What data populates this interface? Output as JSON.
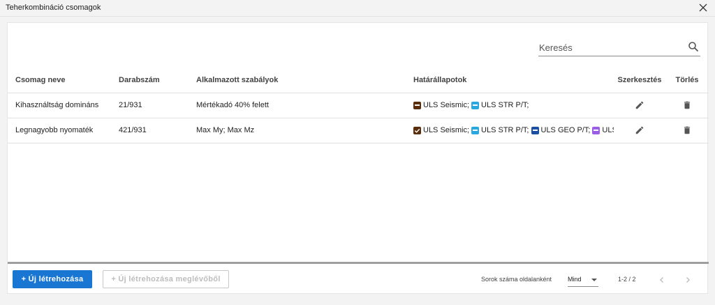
{
  "window": {
    "title": "Teherkombináció csomagok"
  },
  "search": {
    "placeholder": "Keresés"
  },
  "table": {
    "columns": [
      "Csomag neve",
      "Darabszám",
      "Alkalmazott szabályok",
      "Határállapotok",
      "Szerkesztés",
      "Törlés"
    ],
    "rows": [
      {
        "name": "Kihasználtság domináns",
        "count": "21/931",
        "rules": "Mértékadó 40% felett",
        "states": [
          {
            "label": "ULS Seismic;",
            "color": "#5a2d0c",
            "mark": "dash"
          },
          {
            "label": "ULS STR P/T;",
            "color": "#29a8e0",
            "mark": "dash"
          }
        ]
      },
      {
        "name": "Legnagyobb nyomaték",
        "count": "421/931",
        "rules": "Max My; Max Mz",
        "states": [
          {
            "label": "ULS Seismic;",
            "color": "#5a2d0c",
            "mark": "check"
          },
          {
            "label": "ULS STR P/T;",
            "color": "#29a8e0",
            "mark": "dash"
          },
          {
            "label": "ULS GEO P/T;",
            "color": "#1a4fa3",
            "mark": "dash"
          },
          {
            "label": "ULS...",
            "color": "#9b5de5",
            "mark": "dash"
          }
        ]
      }
    ]
  },
  "footer": {
    "new_button": "+ Új létrehozása",
    "new_from_existing_button": "+ Új létrehozása meglévőből",
    "rows_per_page_label": "Sorok száma oldalanként",
    "rows_per_page_value": "Mind",
    "range": "1-2 / 2"
  },
  "icons": {
    "close": "close-icon",
    "search": "search-icon",
    "edit": "pencil-icon",
    "delete": "trash-icon",
    "prev": "chevron-left-icon",
    "next": "chevron-right-icon"
  },
  "colors": {
    "primary": "#1976d2"
  }
}
